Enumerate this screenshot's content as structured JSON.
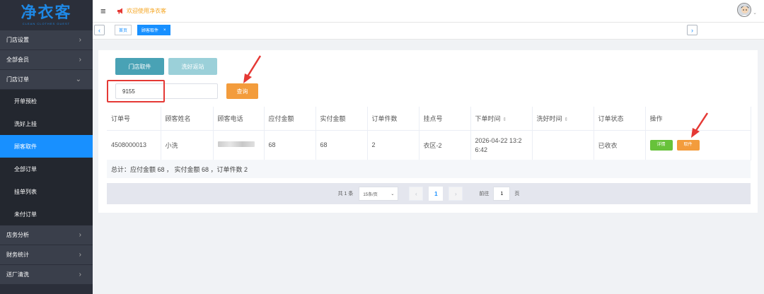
{
  "sidebar": {
    "logo_text": "净衣客",
    "logo_subtitle": "CLEAN CLOTHES GUEST",
    "groups": [
      {
        "label": "门店设置"
      },
      {
        "label": "全部会员"
      },
      {
        "label": "门店订单"
      }
    ],
    "sub_items": [
      {
        "label": "开单预检"
      },
      {
        "label": "洗好上挂"
      },
      {
        "label": "顾客取件"
      },
      {
        "label": "全部订单"
      },
      {
        "label": "挂单列表"
      },
      {
        "label": "未付订单"
      }
    ],
    "active_item": "顾客取件",
    "bottom_groups": [
      {
        "label": "店务分析"
      },
      {
        "label": "财务统计"
      },
      {
        "label": "送厂清洗"
      }
    ]
  },
  "topbar": {
    "welcome_text": "欢迎使用净衣客"
  },
  "tabs": {
    "home_label": "首页",
    "current_label": "顾客取件",
    "close_glyph": "×"
  },
  "actions": {
    "store_pickup_label": "门店取件",
    "wash_return_label": "洗好返站",
    "search_value": "9155",
    "search_button_label": "查询"
  },
  "table": {
    "headers": [
      "订单号",
      "顾客姓名",
      "顾客电话",
      "应付金额",
      "实付金额",
      "订单件数",
      "挂点号",
      "下单时间",
      "洗好时间",
      "订单状态",
      "操作"
    ],
    "rows": [
      {
        "order_no": "4508000013",
        "customer_name": "小洗",
        "phone": "",
        "amount_due": "68",
        "amount_paid": "68",
        "item_count": "2",
        "hang_no": "衣区-2",
        "order_time_line1": "2026-04-22 13:2",
        "order_time_line2": "6:42",
        "washed_time": "",
        "status": "已收衣",
        "detail_label": "详情",
        "pickup_label": "取件"
      }
    ],
    "summary": "总计：应付金额 68 ， 实付金额 68 ，订单件数 2"
  },
  "pagination": {
    "total": "共 1 条",
    "page_size": "15条/页",
    "current_page": "1",
    "goto_label": "前往",
    "goto_value": "1",
    "page_suffix": "页"
  },
  "colors": {
    "sidebar_bg": "#2b2f3a",
    "active_blue": "#1890ff",
    "teal": "#49a2b5",
    "orange": "#f39c3c",
    "green": "#67c23a",
    "annotation_red": "#e53935"
  }
}
